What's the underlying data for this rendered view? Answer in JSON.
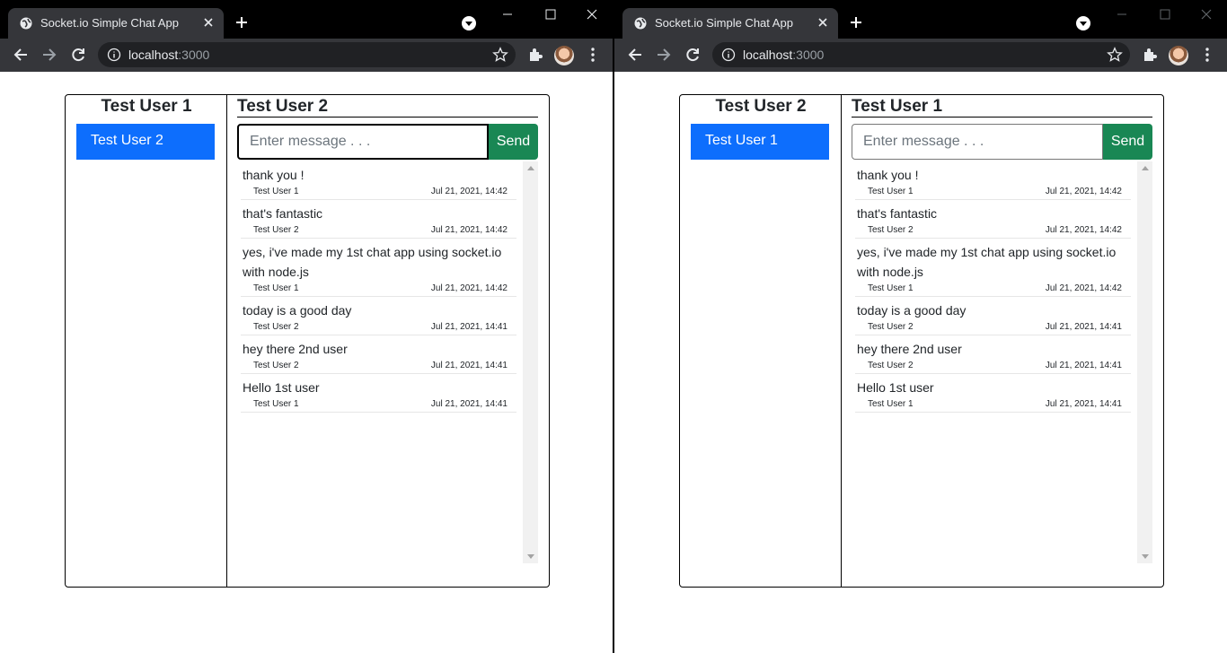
{
  "colors": {
    "accent": "#0d6efd",
    "send": "#198754",
    "tab_bg": "#35363a",
    "frame": "#000000"
  },
  "windows": [
    {
      "tab_title": "Socket.io Simple Chat App",
      "url_host": "localhost",
      "url_port": ":3000",
      "current_user": "Test User 1",
      "contact": "Test User 2",
      "peer": "Test User 2",
      "input_placeholder": "Enter message . . .",
      "send_label": "Send",
      "messages": [
        {
          "text": "thank you !",
          "user": "Test User 1",
          "time": "Jul 21, 2021, 14:42"
        },
        {
          "text": "that's fantastic",
          "user": "Test User 2",
          "time": "Jul 21, 2021, 14:42"
        },
        {
          "text": "yes, i've made my 1st chat app using socket.io with node.js",
          "user": "Test User 1",
          "time": "Jul 21, 2021, 14:42"
        },
        {
          "text": "today is a good day",
          "user": "Test User 2",
          "time": "Jul 21, 2021, 14:41"
        },
        {
          "text": "hey there 2nd user",
          "user": "Test User 2",
          "time": "Jul 21, 2021, 14:41"
        },
        {
          "text": "Hello 1st user",
          "user": "Test User 1",
          "time": "Jul 21, 2021, 14:41"
        }
      ]
    },
    {
      "tab_title": "Socket.io Simple Chat App",
      "url_host": "localhost",
      "url_port": ":3000",
      "current_user": "Test User 2",
      "contact": "Test User 1",
      "peer": "Test User 1",
      "input_placeholder": "Enter message . . .",
      "send_label": "Send",
      "messages": [
        {
          "text": "thank you !",
          "user": "Test User 1",
          "time": "Jul 21, 2021, 14:42"
        },
        {
          "text": "that's fantastic",
          "user": "Test User 2",
          "time": "Jul 21, 2021, 14:42"
        },
        {
          "text": "yes, i've made my 1st chat app using socket.io with node.js",
          "user": "Test User 1",
          "time": "Jul 21, 2021, 14:42"
        },
        {
          "text": "today is a good day",
          "user": "Test User 2",
          "time": "Jul 21, 2021, 14:41"
        },
        {
          "text": "hey there 2nd user",
          "user": "Test User 2",
          "time": "Jul 21, 2021, 14:41"
        },
        {
          "text": "Hello 1st user",
          "user": "Test User 1",
          "time": "Jul 21, 2021, 14:41"
        }
      ]
    }
  ]
}
